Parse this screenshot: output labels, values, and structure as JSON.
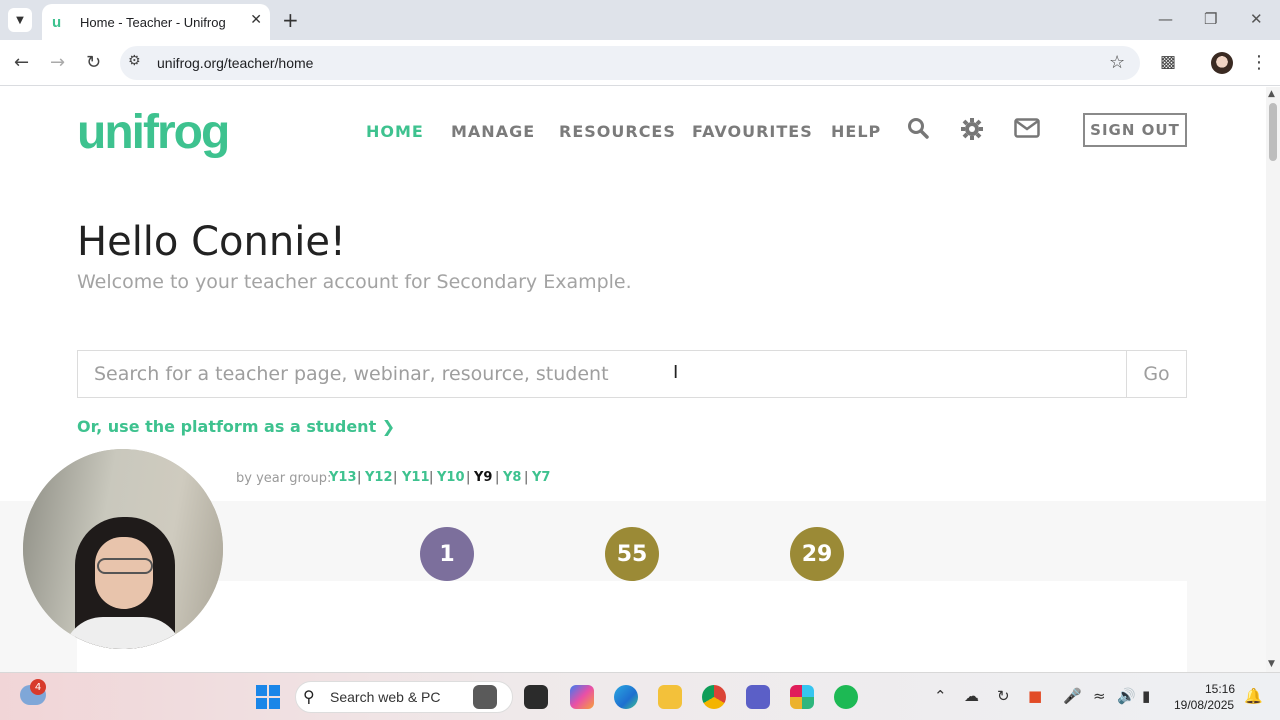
{
  "browser": {
    "tab_title": "Home - Teacher - Unifrog",
    "tab_favicon": "u",
    "url": "unifrog.org/teacher/home"
  },
  "site": {
    "logo": "unifrog",
    "nav": [
      {
        "label": "HOME",
        "active": true
      },
      {
        "label": "MANAGE",
        "active": false
      },
      {
        "label": "RESOURCES",
        "active": false
      },
      {
        "label": "FAVOURITES",
        "active": false
      },
      {
        "label": "HELP",
        "active": false
      }
    ],
    "icons": [
      "search-icon",
      "gear-icon",
      "envelope-icon"
    ],
    "sign_out": "SIGN OUT",
    "accent_color": "#3ec28f"
  },
  "main": {
    "greeting": "Hello Connie!",
    "welcome": "Welcome to your teacher account for Secondary Example.",
    "search_placeholder": "Search for a teacher page, webinar, resource, student",
    "search_button": "Go",
    "student_link": "Or, use the platform as a student"
  },
  "stats": {
    "filter_label": "by year group:",
    "year_groups": [
      "Y13",
      "Y12",
      "Y11",
      "Y10",
      "Y9",
      "Y8",
      "Y7"
    ],
    "current_year": "Y9",
    "counters": [
      {
        "value": "1",
        "color": "#7c6f9c"
      },
      {
        "value": "55",
        "color": "#9b8a36"
      },
      {
        "value": "29",
        "color": "#9b8a36"
      }
    ]
  },
  "taskbar": {
    "weather_badge": "4",
    "search_text": "Search web & PC",
    "time": "15:16",
    "date": "19/08/2025"
  }
}
